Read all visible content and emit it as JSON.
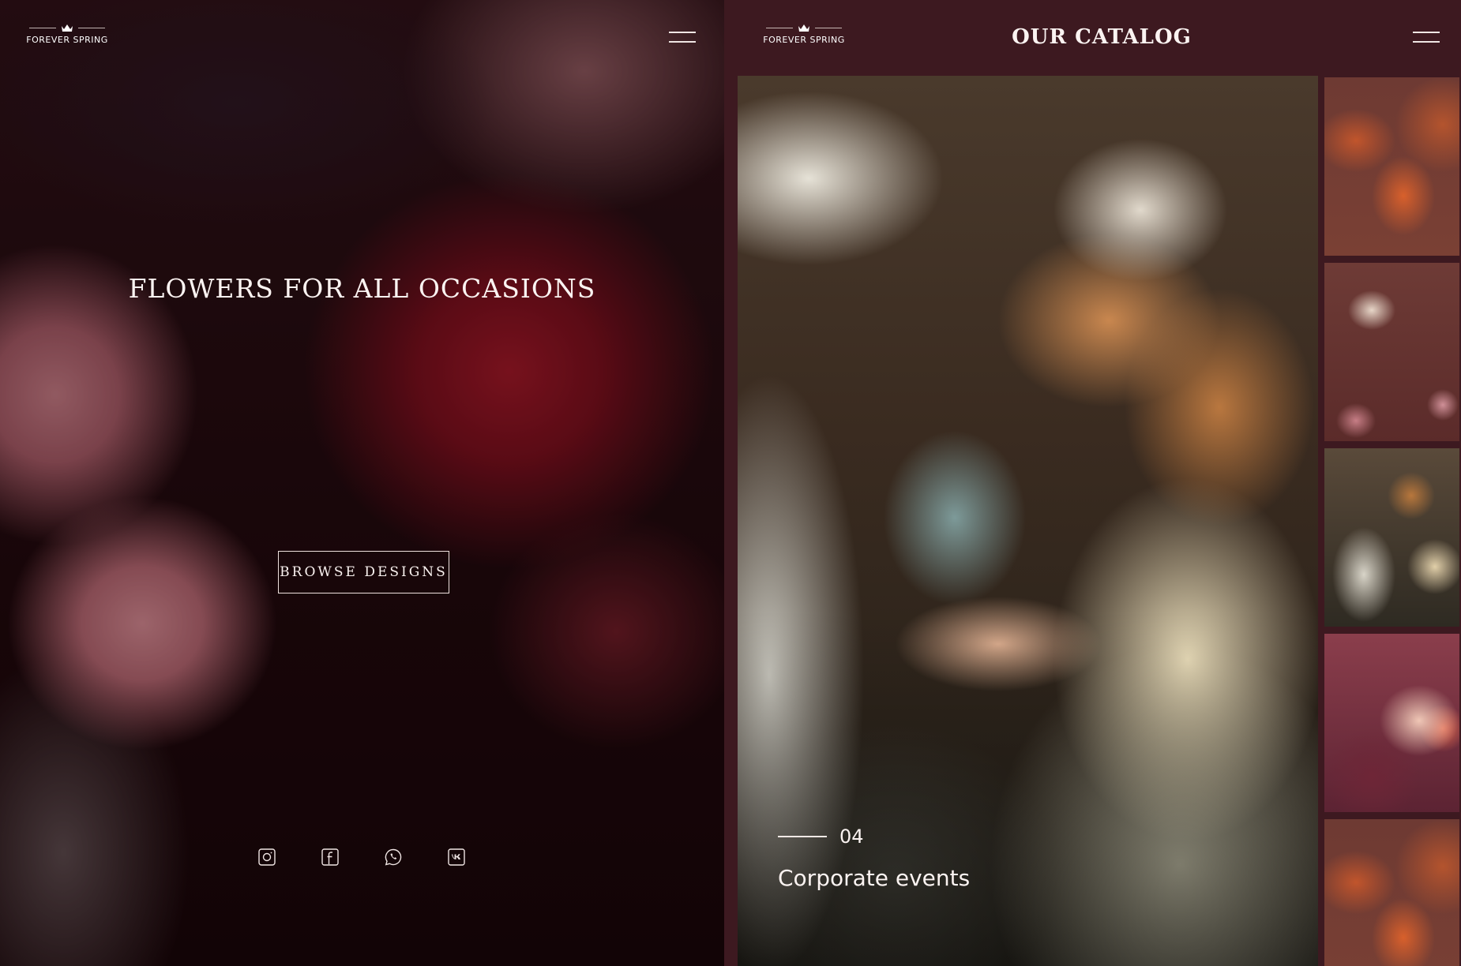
{
  "brand": {
    "name": "FOREVER SPRING"
  },
  "hero": {
    "title": "FLOWERS FOR ALL OCCASIONS",
    "cta_label": "BROWSE DESIGNS"
  },
  "socials": [
    {
      "icon": "instagram-icon"
    },
    {
      "icon": "facebook-icon"
    },
    {
      "icon": "whatsapp-icon"
    },
    {
      "icon": "vk-icon"
    }
  ],
  "catalog": {
    "title": "OUR CATALOG",
    "current_slide": {
      "number": "04",
      "caption": "Corporate events"
    },
    "thumbnails": [
      {
        "subject": "orange tulips"
      },
      {
        "subject": "tea and roses table"
      },
      {
        "subject": "event hall"
      },
      {
        "subject": "rose bouquet"
      },
      {
        "subject": "orange tulips"
      }
    ]
  },
  "colors": {
    "catalog_background": "#3d1920",
    "text": "#fbf3f1"
  }
}
